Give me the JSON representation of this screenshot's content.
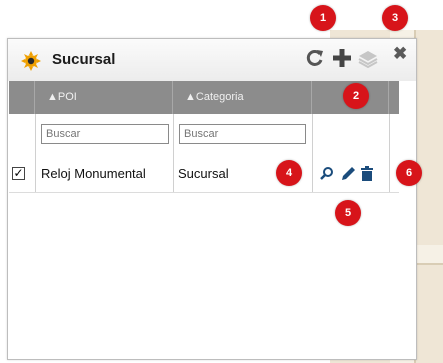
{
  "panel": {
    "title": "Sucursal",
    "refresh_icon": "refresh-icon",
    "add_icon": "plus-icon",
    "layers_icon": "layers-icon",
    "close_label": "✖"
  },
  "grid": {
    "columns": [
      {
        "label": "▲POI"
      },
      {
        "label": "▲Categoria"
      }
    ],
    "filters": [
      {
        "placeholder": "Buscar"
      },
      {
        "placeholder": "Buscar"
      }
    ],
    "rows": [
      {
        "checked": true,
        "poi": "Reloj Monumental",
        "categoria": "Sucursal"
      }
    ],
    "row_actions": [
      "search-icon",
      "pencil-icon",
      "trash-icon"
    ]
  },
  "badges": [
    "1",
    "2",
    "3",
    "4",
    "5",
    "6"
  ],
  "colors": {
    "badge": "#d7141a",
    "header": "#8c8c8c",
    "title_icon": "#f0a000"
  }
}
